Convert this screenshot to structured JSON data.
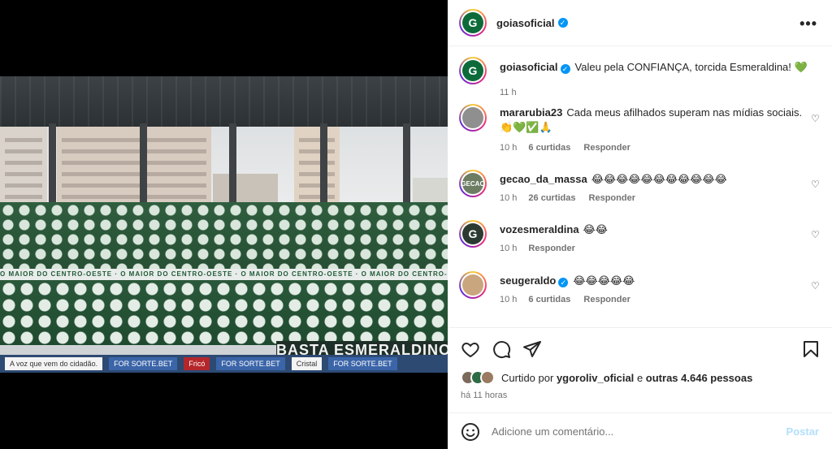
{
  "post": {
    "username": "goiasoficial",
    "avatar_letter": "G",
    "caption": "Valeu pela CONFIANÇA, torcida Esmeraldina! 💚",
    "caption_time": "11 h",
    "more_icon": "more-options-icon"
  },
  "photo": {
    "banner_text": "O MAIOR DO CENTRO-OESTE · O MAIOR DO CENTRO-OESTE · O MAIOR DO CENTRO-OESTE · O MAIOR DO CENTRO-OESTE",
    "big_banner": "BASTA ESMERALDINOS",
    "ads": [
      "A voz que vem do cidadão.",
      "FOR SORTE.BET",
      "Fricó",
      "FOR SORTE.BET",
      "Cristal",
      "FOR SORTE.BET"
    ]
  },
  "comments": [
    {
      "username": "mararubia23",
      "verified": false,
      "text": "Cada meus afilhados superam nas mídias sociais. 👏💚✅🙏",
      "time": "10 h",
      "likes": "6 curtidas",
      "reply": "Responder"
    },
    {
      "username": "gecao_da_massa",
      "verified": false,
      "text": "😂😂😂😂😂😂😂😂😂😂😂",
      "time": "10 h",
      "likes": "26 curtidas",
      "reply": "Responder"
    },
    {
      "username": "vozesmeraldina",
      "verified": false,
      "text": "😂😂",
      "time": "10 h",
      "likes": "",
      "reply": "Responder"
    },
    {
      "username": "seugeraldo",
      "verified": true,
      "text": "😂😂😂😂😂",
      "time": "10 h",
      "likes": "6 curtidas",
      "reply": "Responder"
    }
  ],
  "actions": {
    "liked_by_prefix": "Curtido por",
    "liked_by_user": "ygoroliv_oficial",
    "liked_by_middle": "e",
    "liked_by_others": "outras 4.646 pessoas",
    "time_ago": "há 11 horas",
    "comment_placeholder": "Adicione um comentário...",
    "post_label": "Postar"
  }
}
